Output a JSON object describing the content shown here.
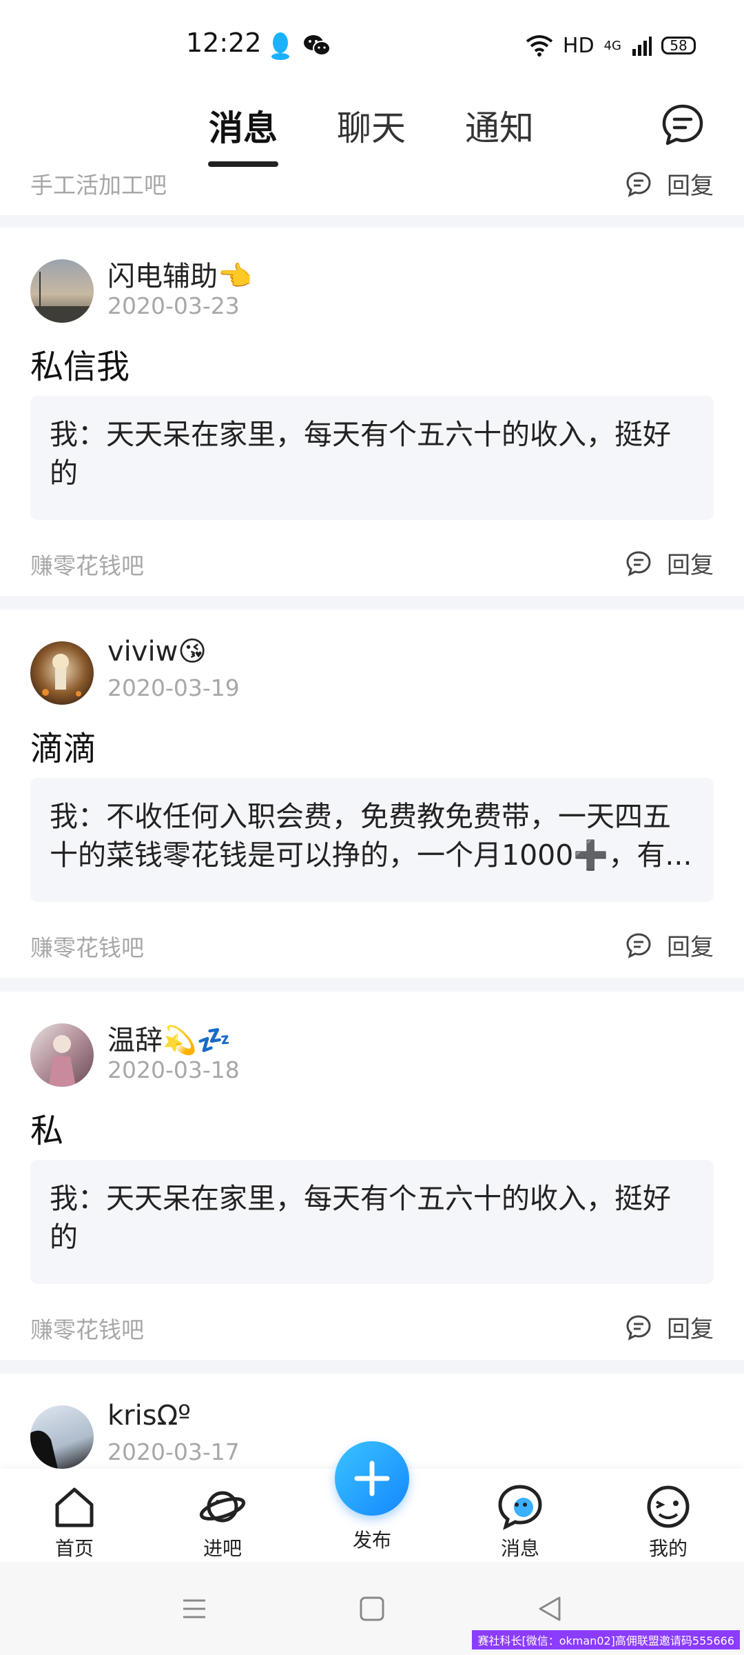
{
  "status_bar": {
    "time": "12:22",
    "network": "HD",
    "signal": "4G",
    "battery": "58"
  },
  "top_tabs": {
    "items": [
      "消息",
      "聊天",
      "通知"
    ],
    "active": "消息"
  },
  "partial_post": {
    "forum": "手工活加工吧",
    "reply_label": "回复"
  },
  "posts": [
    {
      "username": "闪电辅助👈",
      "date": "2020-03-23",
      "title": "私信我",
      "quote": "我：天天呆在家里，每天有个五六十的收入，挺好的",
      "forum": "赚零花钱吧",
      "reply_label": "回复"
    },
    {
      "username": "viviw😘",
      "date": "2020-03-19",
      "title": "滴滴",
      "quote": "我：不收任何入职会费，免费教免费带，一天四五十的菜钱零花钱是可以挣的，一个月1000➕，有...",
      "forum": "赚零花钱吧",
      "reply_label": "回复"
    },
    {
      "username": "温辞💫💤",
      "date": "2020-03-18",
      "title": "私",
      "quote": "我：天天呆在家里，每天有个五六十的收入，挺好的",
      "forum": "赚零花钱吧",
      "reply_label": "回复"
    },
    {
      "username": "krisΩº",
      "date": "2020-03-17"
    }
  ],
  "bottom_nav": {
    "home": "首页",
    "forums": "进吧",
    "post": "发布",
    "messages": "消息",
    "mine": "我的"
  },
  "watermark": "赛社科长[微信：okman02]高佣联盟邀请码555666"
}
